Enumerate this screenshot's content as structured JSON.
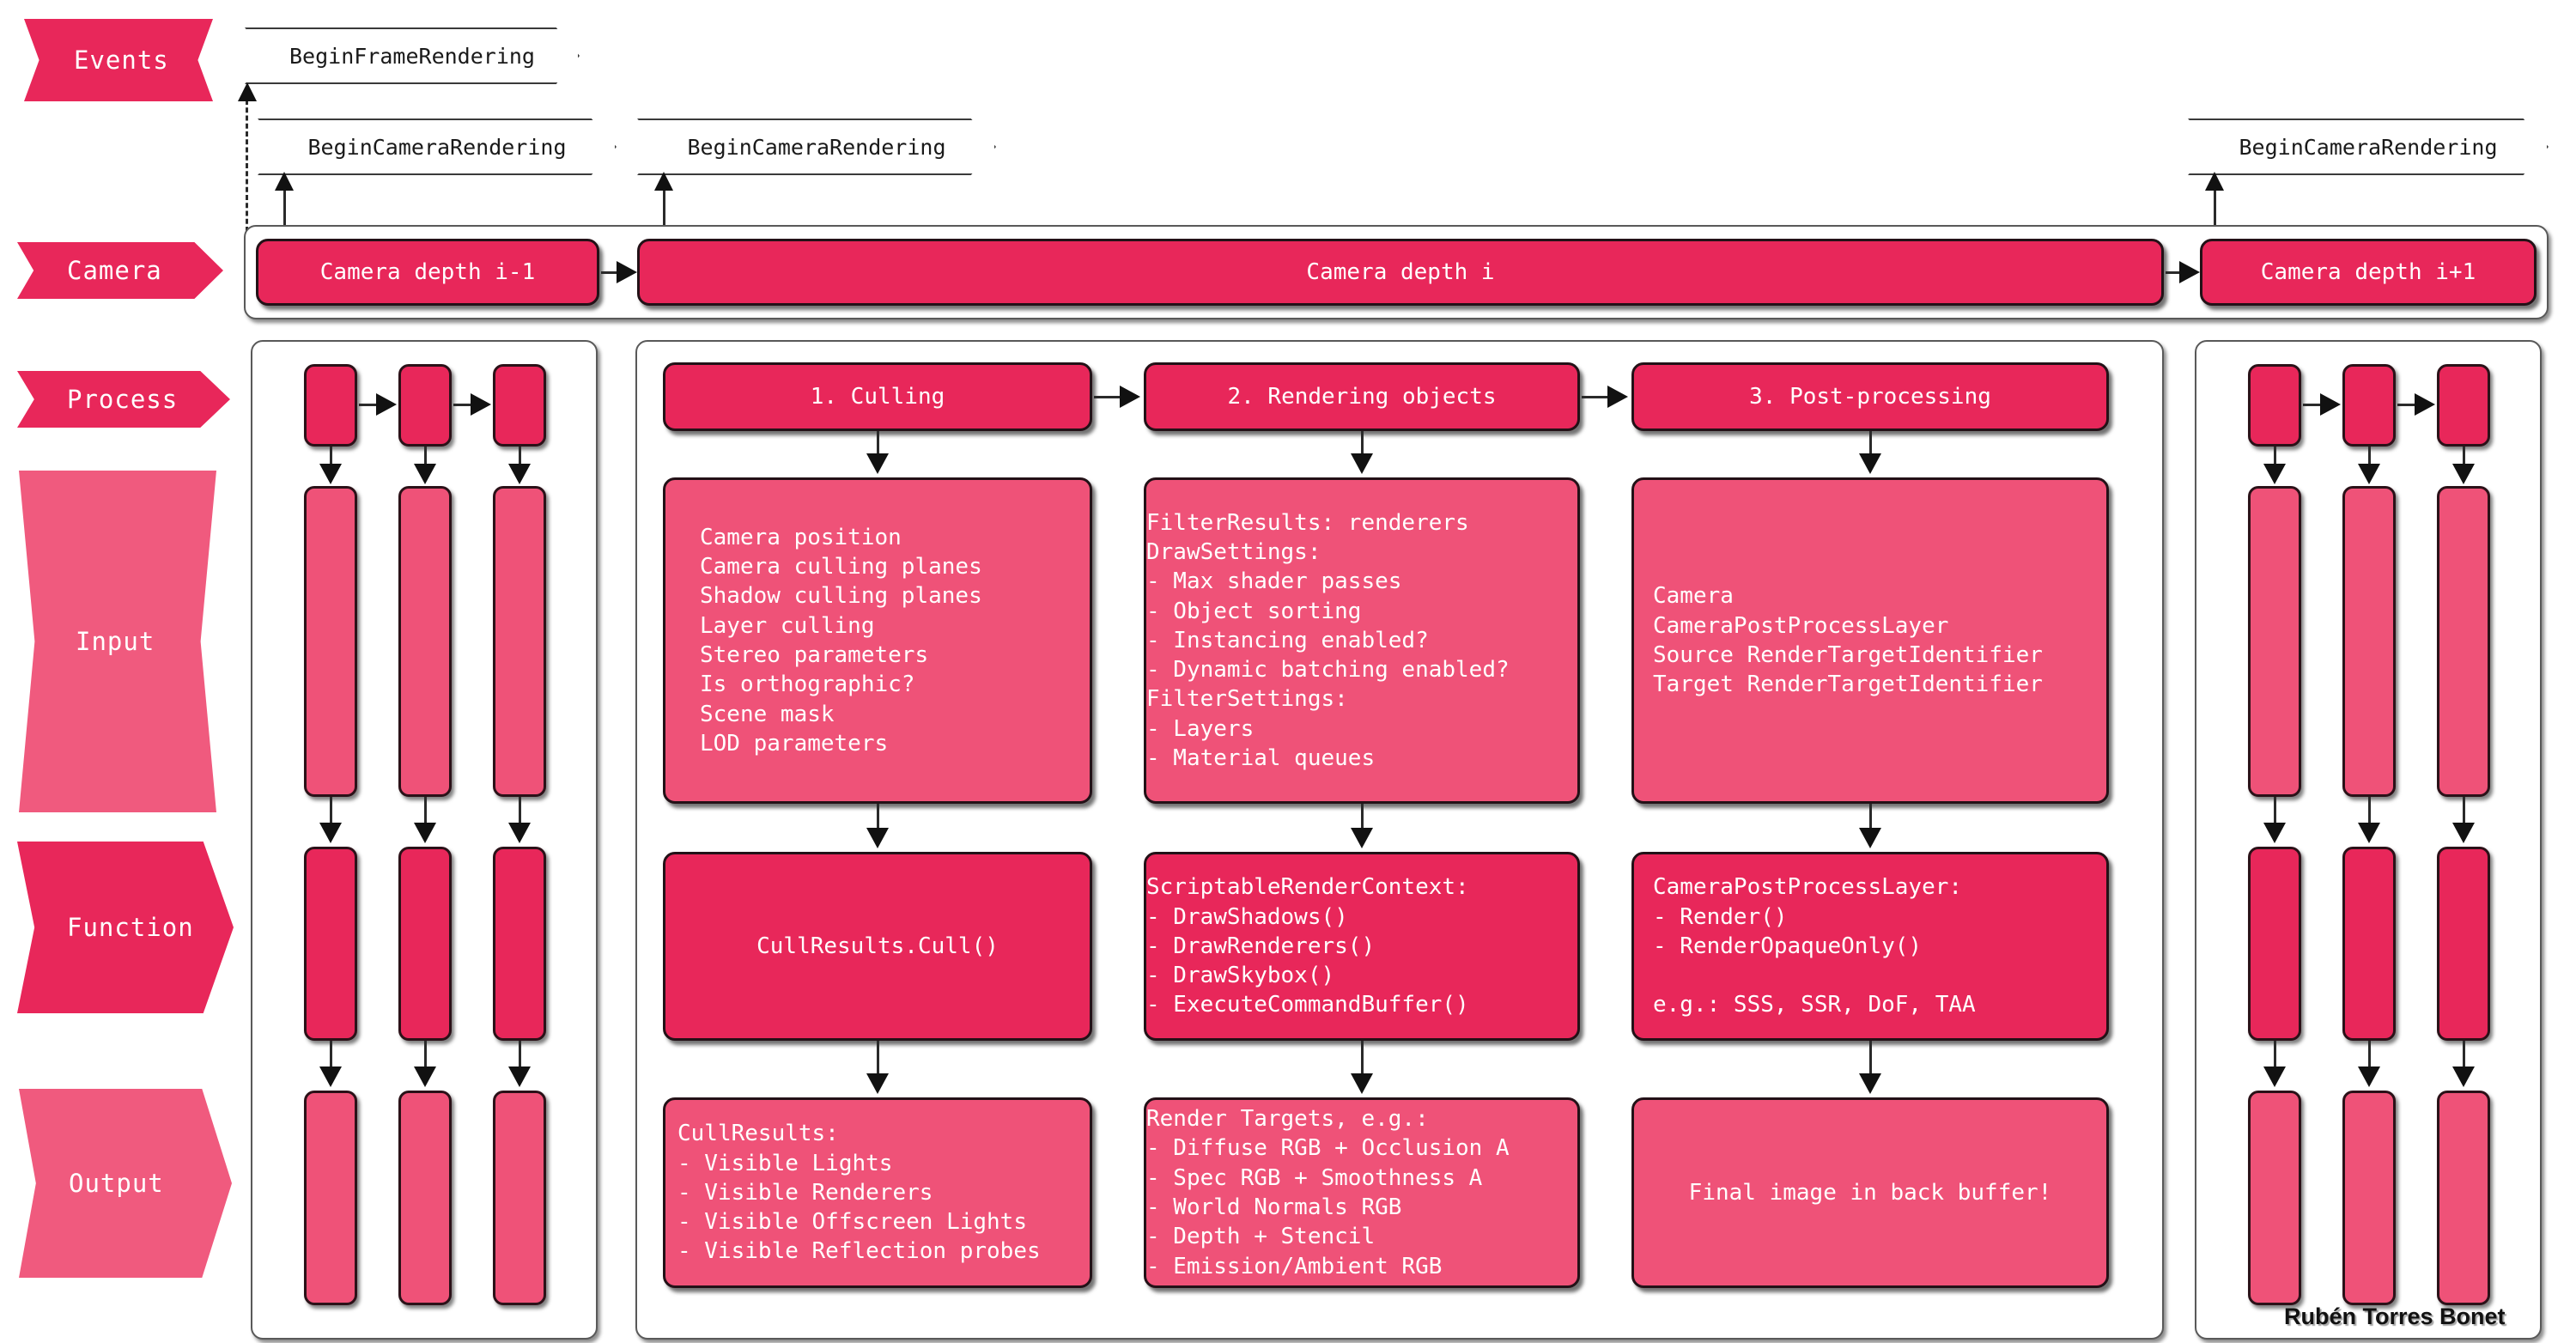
{
  "diagram": {
    "title": "Unity SRP camera rendering pipeline",
    "signature": "Rubén Torres Bonet",
    "colors": {
      "accent_dark": "#E8275A",
      "accent_light": "#EF5278",
      "outline": "#231117",
      "frame": "#595959",
      "text_on_accent": "#FFFFFF",
      "connector": "#111111",
      "background": "#FFFFFF"
    }
  },
  "row_labels": [
    {
      "id": "events",
      "label": "Events",
      "tone": "dark",
      "shape": "wavy"
    },
    {
      "id": "camera",
      "label": "Camera",
      "tone": "dark",
      "shape": "chev-arrow"
    },
    {
      "id": "process",
      "label": "Process",
      "tone": "dark",
      "shape": "chev-arrow"
    },
    {
      "id": "input",
      "label": "Input",
      "tone": "light",
      "shape": "wavy"
    },
    {
      "id": "function",
      "label": "Function",
      "tone": "dark",
      "shape": "chev-arrow"
    },
    {
      "id": "output",
      "label": "Output",
      "tone": "light",
      "shape": "chev-arrow"
    }
  ],
  "events": [
    {
      "id": "begin-frame-rendering",
      "label": "BeginFrameRendering"
    },
    {
      "id": "begin-camera-rendering-1",
      "label": "BeginCameraRendering"
    },
    {
      "id": "begin-camera-rendering-2",
      "label": "BeginCameraRendering"
    },
    {
      "id": "begin-camera-rendering-3",
      "label": "BeginCameraRendering"
    }
  ],
  "cameras": [
    {
      "id": "camera-depth-prev",
      "label": "Camera depth i-1"
    },
    {
      "id": "camera-depth-current",
      "label": "Camera depth i"
    },
    {
      "id": "camera-depth-next",
      "label": "Camera depth i+1"
    }
  ],
  "stages": [
    {
      "id": "culling",
      "process": "1. Culling",
      "input": "Camera position\nCamera culling planes\nShadow culling planes\nLayer culling\nStereo parameters\nIs orthographic?\nScene mask\nLOD parameters",
      "function": "CullResults.Cull()",
      "function_align": "center",
      "output": "CullResults:\n- Visible Lights\n- Visible Renderers\n- Visible Offscreen Lights\n- Visible Reflection probes"
    },
    {
      "id": "rendering-objects",
      "process": "2. Rendering objects",
      "input": "FilterResults: renderers\nDrawSettings:\n- Max shader passes\n- Object sorting\n- Instancing enabled?\n- Dynamic batching enabled?\nFilterSettings:\n- Layers\n- Material queues",
      "function": "ScriptableRenderContext:\n- DrawShadows()\n- DrawRenderers()\n- DrawSkybox()\n- ExecuteCommandBuffer()",
      "function_align": "left",
      "output": "Render Targets, e.g.:\n- Diffuse RGB + Occlusion A\n- Spec RGB + Smoothness A\n- World Normals RGB\n- Depth + Stencil\n- Emission/Ambient RGB"
    },
    {
      "id": "post-processing",
      "process": "3. Post-processing",
      "input": "Camera\nCameraPostProcessLayer\nSource RenderTargetIdentifier\nTarget RenderTargetIdentifier",
      "function": "CameraPostProcessLayer:\n- Render()\n- RenderOpaqueOnly()\n\ne.g.: SSS, SSR, DoF, TAA",
      "function_align": "left",
      "output": "Final image in back buffer!"
    }
  ],
  "collapsed_pipelines": [
    {
      "id": "previous-camera-pipeline",
      "side": "left"
    },
    {
      "id": "next-camera-pipeline",
      "side": "right"
    }
  ]
}
